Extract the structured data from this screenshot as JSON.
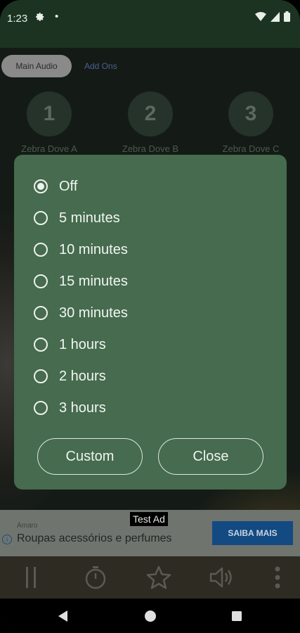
{
  "status_bar": {
    "time": "1:23"
  },
  "tabs": {
    "main": "Main Audio",
    "addons": "Add Ons"
  },
  "sounds": [
    {
      "number": "1",
      "label": "Zebra Dove A"
    },
    {
      "number": "2",
      "label": "Zebra Dove B"
    },
    {
      "number": "3",
      "label": "Zebra Dove C"
    }
  ],
  "timer_dialog": {
    "options": [
      "Off",
      "5 minutes",
      "10 minutes",
      "15 minutes",
      "30 minutes",
      "1 hours",
      "2 hours",
      "3 hours"
    ],
    "selected": "Off",
    "custom_label": "Custom",
    "close_label": "Close"
  },
  "ad": {
    "tag": "Test Ad",
    "brand": "Amaro",
    "title": "Roupas acessórios e perfumes",
    "cta": "SAIBA MAIS"
  },
  "icons": {
    "pause": "pause-icon",
    "timer": "timer-icon",
    "favorite": "star-icon",
    "volume": "volume-icon",
    "more": "more-vert-icon"
  },
  "colors": {
    "dialog_bg": "#466b4e",
    "status_bar_bg": "#1c3322",
    "ad_cta_bg": "#134a82"
  }
}
